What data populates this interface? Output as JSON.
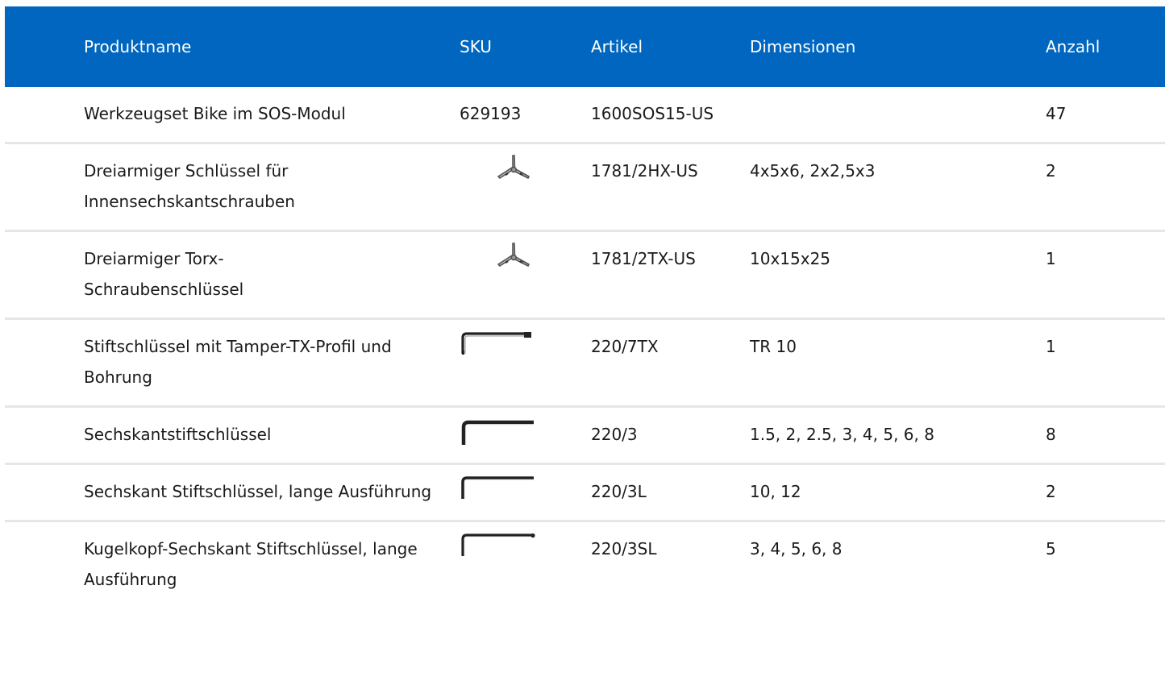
{
  "table": {
    "headers": [
      "Produktname",
      "SKU",
      "Artikel",
      "Dimensionen",
      "Anzahl"
    ],
    "rows": [
      {
        "name": "Werkzeugset Bike im SOS-Modul",
        "sku": "629193",
        "sku_icon": "",
        "artikel": "1600SOS15-US",
        "dimensionen": "",
        "anzahl": "47"
      },
      {
        "name": "Dreiarmiger Schlüssel für Innensechskantschrauben",
        "sku": "",
        "sku_icon": "three-arm-wrench-icon",
        "artikel": "1781/2HX-US",
        "dimensionen": "4x5x6, 2x2,5x3",
        "anzahl": "2"
      },
      {
        "name": "Dreiarmiger Torx-Schraubenschlüssel",
        "sku": "",
        "sku_icon": "three-arm-wrench-icon",
        "artikel": "1781/2TX-US",
        "dimensionen": "10x15x25",
        "anzahl": "1"
      },
      {
        "name": "Stiftschlüssel mit Tamper-TX-Profil und Bohrung",
        "sku": "",
        "sku_icon": "l-key-wrench-icon",
        "artikel": "220/7TX",
        "dimensionen": "TR 10",
        "anzahl": "1"
      },
      {
        "name": "Sechskantstiftschlüssel",
        "sku": "",
        "sku_icon": "l-key-wrench-icon",
        "artikel": "220/3",
        "dimensionen": "1.5, 2, 2.5, 3, 4, 5, 6, 8",
        "anzahl": "8"
      },
      {
        "name": "Sechskant Stiftschlüssel, lange Ausführung",
        "sku": "",
        "sku_icon": "l-key-wrench-icon",
        "artikel": "220/3L",
        "dimensionen": "10, 12",
        "anzahl": "2"
      },
      {
        "name": "Kugelkopf-Sechskant Stiftschlüssel, lange Ausführung",
        "sku": "",
        "sku_icon": "ball-end-l-key-icon",
        "artikel": "220/3SL",
        "dimensionen": "3, 4, 5, 6, 8",
        "anzahl": "5"
      }
    ]
  },
  "colors": {
    "header_bg": "#0066bf",
    "header_text": "#ffffff",
    "row_divider": "#e6e6e6",
    "body_text": "#1a1a1a"
  }
}
